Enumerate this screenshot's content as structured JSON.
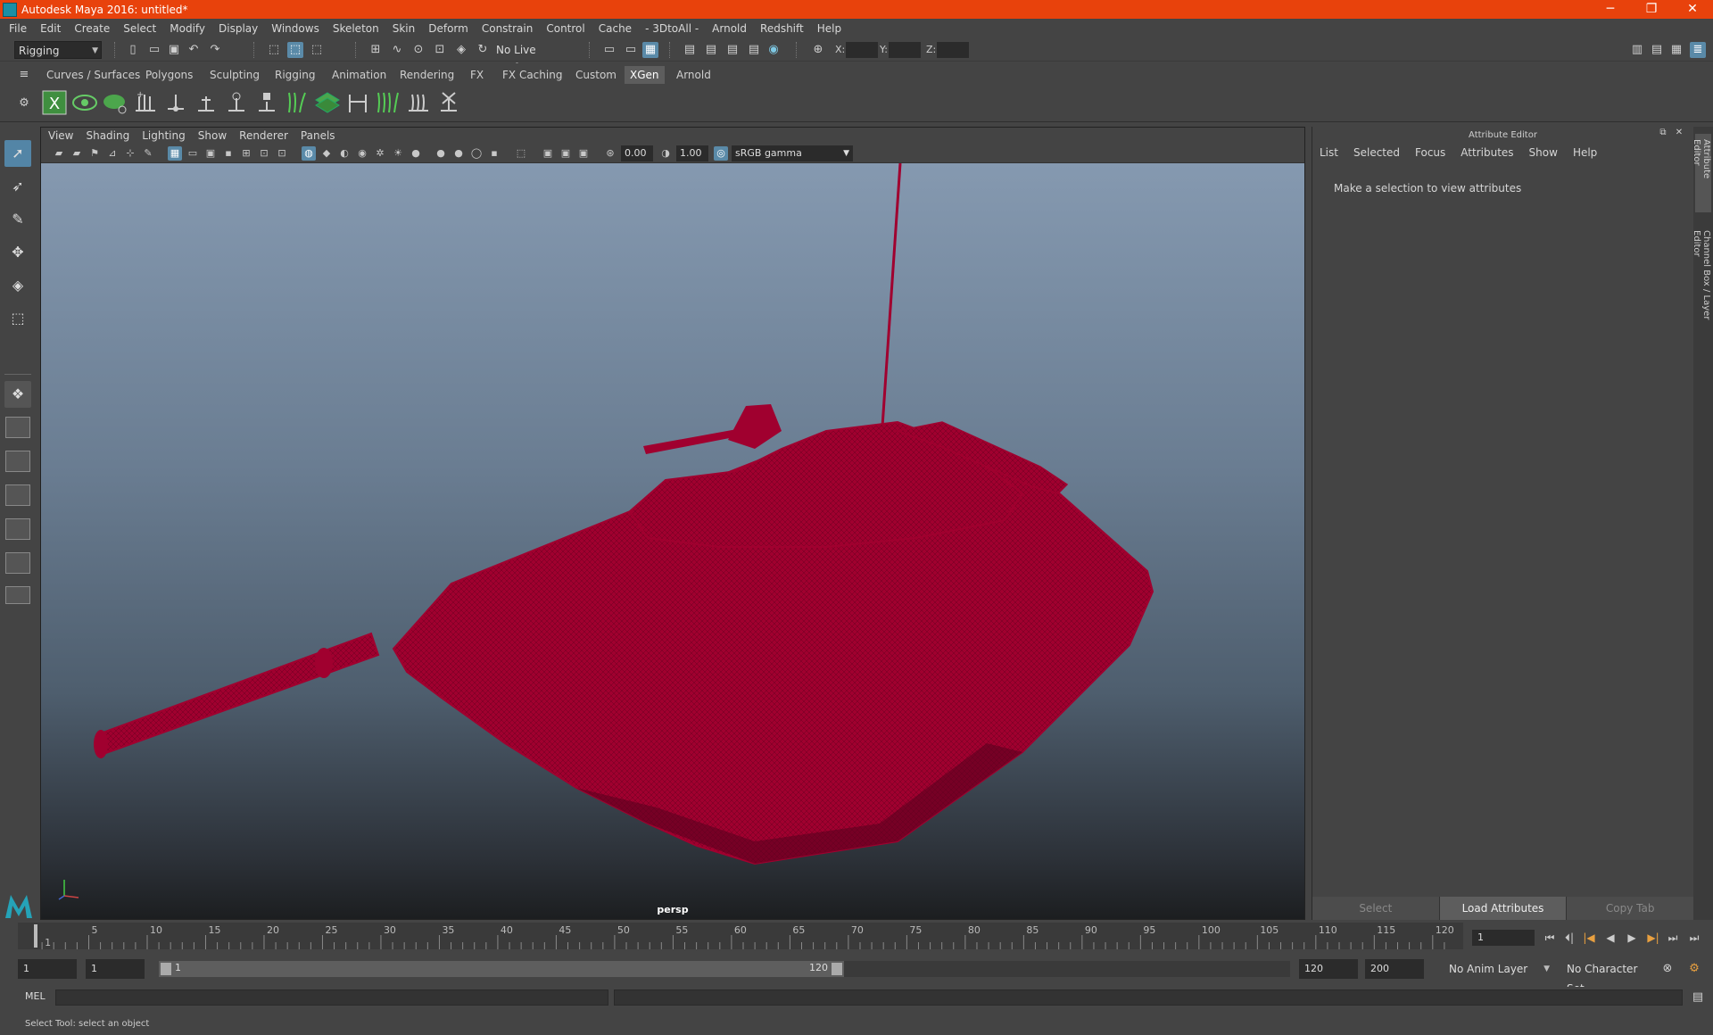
{
  "window": {
    "title": "Autodesk Maya 2016: untitled*",
    "min": "─",
    "max": "❐",
    "close": "✕"
  },
  "menubar": [
    "File",
    "Edit",
    "Create",
    "Select",
    "Modify",
    "Display",
    "Windows",
    "Skeleton",
    "Skin",
    "Deform",
    "Constrain",
    "Control",
    "Cache",
    "- 3DtoAll -",
    "Arnold",
    "Redshift",
    "Help"
  ],
  "status": {
    "menu_set": "Rigging",
    "live_surface": "No Live Surface",
    "x_label": "X:",
    "y_label": "Y:",
    "z_label": "Z:"
  },
  "shelf": {
    "tabs": [
      "Curves / Surfaces",
      "Polygons",
      "Sculpting",
      "Rigging",
      "Animation",
      "Rendering",
      "FX",
      "FX Caching",
      "Custom",
      "XGen",
      "Arnold"
    ],
    "active_tab": "XGen"
  },
  "viewport": {
    "menu": [
      "View",
      "Shading",
      "Lighting",
      "Show",
      "Renderer",
      "Panels"
    ],
    "exposure": "0.00",
    "gamma": "1.00",
    "color_space": "sRGB gamma",
    "camera": "persp",
    "wireframe_color": "#a0002f"
  },
  "attribute_editor": {
    "title": "Attribute Editor",
    "menu": [
      "List",
      "Selected",
      "Focus",
      "Attributes",
      "Show",
      "Help"
    ],
    "message": "Make a selection to view attributes",
    "buttons": [
      "Select",
      "Load Attributes",
      "Copy Tab"
    ],
    "side_tabs": [
      "Attribute Editor",
      "Channel Box / Layer Editor"
    ]
  },
  "timeline": {
    "ticks": [
      "1",
      "5",
      "10",
      "15",
      "20",
      "25",
      "30",
      "35",
      "40",
      "45",
      "50",
      "55",
      "60",
      "65",
      "70",
      "75",
      "80",
      "85",
      "90",
      "95",
      "100",
      "105",
      "110",
      "115",
      "120"
    ],
    "current_frame": "1",
    "playback_buttons": [
      "⏮",
      "⏴|",
      "|◀",
      "◀",
      "▶",
      "▶|",
      "⏭",
      "⏭"
    ]
  },
  "range": {
    "start": "1",
    "anim_start": "1",
    "bar_start": "1",
    "bar_end": "120",
    "anim_end": "120",
    "end": "200",
    "anim_layer": "No Anim Layer",
    "character_set": "No Character Set"
  },
  "command": {
    "label": "MEL"
  },
  "help_line": "Select Tool: select an object"
}
